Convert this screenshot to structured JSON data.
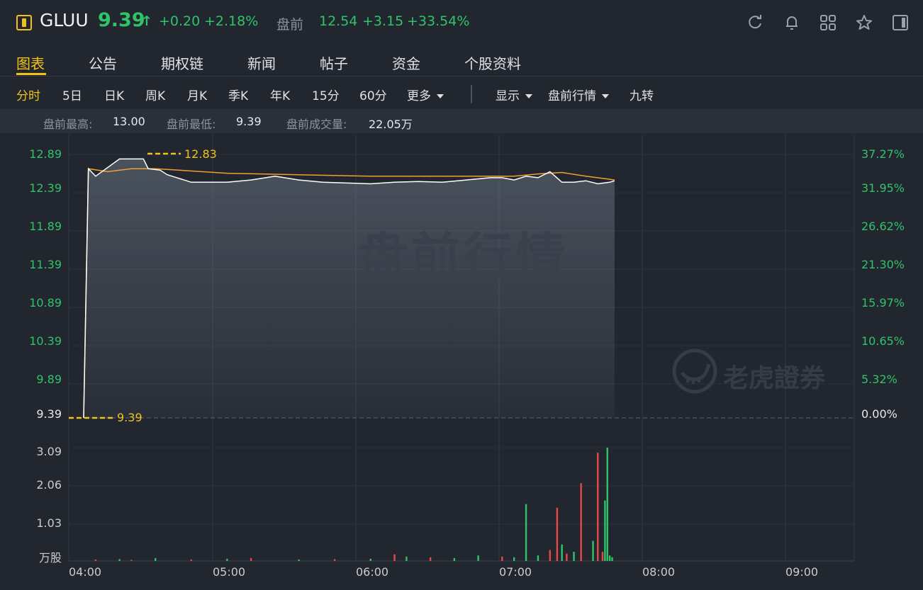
{
  "header": {
    "symbol": "GLUU",
    "price": "9.39",
    "arrow": "↑",
    "change": "+0.20",
    "change_pct": "+2.18%",
    "premarket_label": "盘前",
    "premarket_price": "12.54",
    "premarket_change": "+3.15",
    "premarket_change_pct": "+33.54%",
    "icons": [
      "refresh-icon",
      "bell-icon",
      "grid-icon",
      "star-icon",
      "panel-icon"
    ]
  },
  "tabs": [
    {
      "label": "图表",
      "active": true
    },
    {
      "label": "公告"
    },
    {
      "label": "期权链"
    },
    {
      "label": "新闻"
    },
    {
      "label": "帖子"
    },
    {
      "label": "资金"
    },
    {
      "label": "个股资料"
    }
  ],
  "periods": {
    "items": [
      "分时",
      "5日",
      "日K",
      "周K",
      "月K",
      "季K",
      "年K",
      "15分",
      "60分"
    ],
    "more": "更多",
    "display": "显示",
    "mode": "盘前行情",
    "nine": "九转"
  },
  "stats": {
    "high_label": "盘前最高:",
    "high_value": "13.00",
    "low_label": "盘前最低:",
    "low_value": "9.39",
    "volume_label": "盘前成交量:",
    "volume_value": "22.05万"
  },
  "watermark": "盘前行情",
  "brand": "老虎證券",
  "colors": {
    "up": "#2fc46a",
    "down": "#e84848",
    "accent": "#f2c21b",
    "avg_line": "#f0a030",
    "price_line": "#ffffff"
  },
  "chart_data": {
    "type": "line",
    "x_ticks": [
      "04:00",
      "05:00",
      "06:00",
      "07:00",
      "08:00",
      "09:00"
    ],
    "price_axis": [
      "12.89",
      "12.39",
      "11.89",
      "11.39",
      "10.89",
      "10.39",
      "9.89",
      "9.39"
    ],
    "pct_axis": [
      "37.27%",
      "31.95%",
      "26.62%",
      "21.30%",
      "15.97%",
      "10.65%",
      "5.32%",
      "0.00%"
    ],
    "volume_axis": [
      "3.09",
      "2.06",
      "1.03",
      "万股"
    ],
    "ref_high_label": "12.83",
    "ref_low_label": "9.39",
    "ylim": [
      9.39,
      12.89
    ],
    "series": [
      {
        "name": "price",
        "x": [
          "04:00",
          "04:02",
          "04:05",
          "04:15",
          "04:25",
          "04:27",
          "04:32",
          "04:35",
          "04:45",
          "04:50",
          "05:00",
          "05:10",
          "05:20",
          "05:30",
          "05:40",
          "05:50",
          "06:00",
          "06:10",
          "06:20",
          "06:30",
          "06:40",
          "06:50",
          "06:55",
          "07:00",
          "07:05",
          "07:10",
          "07:15",
          "07:20",
          "07:25",
          "07:30",
          "07:35",
          "07:40",
          "07:42"
        ],
        "values": [
          9.39,
          12.7,
          12.6,
          12.83,
          12.83,
          12.7,
          12.68,
          12.62,
          12.52,
          12.52,
          12.52,
          12.55,
          12.6,
          12.55,
          12.52,
          12.51,
          12.5,
          12.52,
          12.53,
          12.52,
          12.55,
          12.58,
          12.58,
          12.55,
          12.6,
          12.58,
          12.66,
          12.52,
          12.52,
          12.54,
          12.5,
          12.52,
          12.54
        ]
      },
      {
        "name": "avg",
        "x": [
          "04:00",
          "04:02",
          "04:10",
          "04:20",
          "04:30",
          "04:40",
          "05:00",
          "05:30",
          "06:00",
          "06:30",
          "07:00",
          "07:10",
          "07:20",
          "07:30",
          "07:40",
          "07:42"
        ],
        "values": [
          9.39,
          12.7,
          12.66,
          12.7,
          12.7,
          12.68,
          12.64,
          12.62,
          12.6,
          12.6,
          12.6,
          12.63,
          12.65,
          12.6,
          12.56,
          12.55
        ]
      }
    ],
    "volume": {
      "x": [
        "04:05",
        "04:15",
        "04:20",
        "04:30",
        "04:45",
        "05:00",
        "05:10",
        "05:30",
        "05:45",
        "06:00",
        "06:10",
        "06:15",
        "06:25",
        "06:35",
        "06:45",
        "06:55",
        "07:00",
        "07:05",
        "07:10",
        "07:15",
        "07:18",
        "07:20",
        "07:22",
        "07:25",
        "07:28",
        "07:33",
        "07:35",
        "07:37",
        "07:38",
        "07:39",
        "07:40",
        "07:41"
      ],
      "values": [
        0.04,
        0.05,
        0.03,
        0.08,
        0.04,
        0.06,
        0.08,
        0.04,
        0.05,
        0.06,
        0.18,
        0.12,
        0.1,
        0.08,
        0.15,
        0.12,
        0.1,
        1.55,
        0.15,
        0.3,
        1.45,
        0.45,
        0.2,
        0.25,
        2.12,
        0.55,
        2.95,
        0.25,
        1.65,
        3.09,
        0.15,
        0.1
      ],
      "up": [
        false,
        true,
        false,
        true,
        false,
        true,
        false,
        true,
        false,
        true,
        false,
        true,
        false,
        true,
        true,
        false,
        true,
        true,
        true,
        false,
        false,
        true,
        false,
        true,
        false,
        true,
        false,
        false,
        true,
        true,
        true,
        true
      ]
    }
  }
}
